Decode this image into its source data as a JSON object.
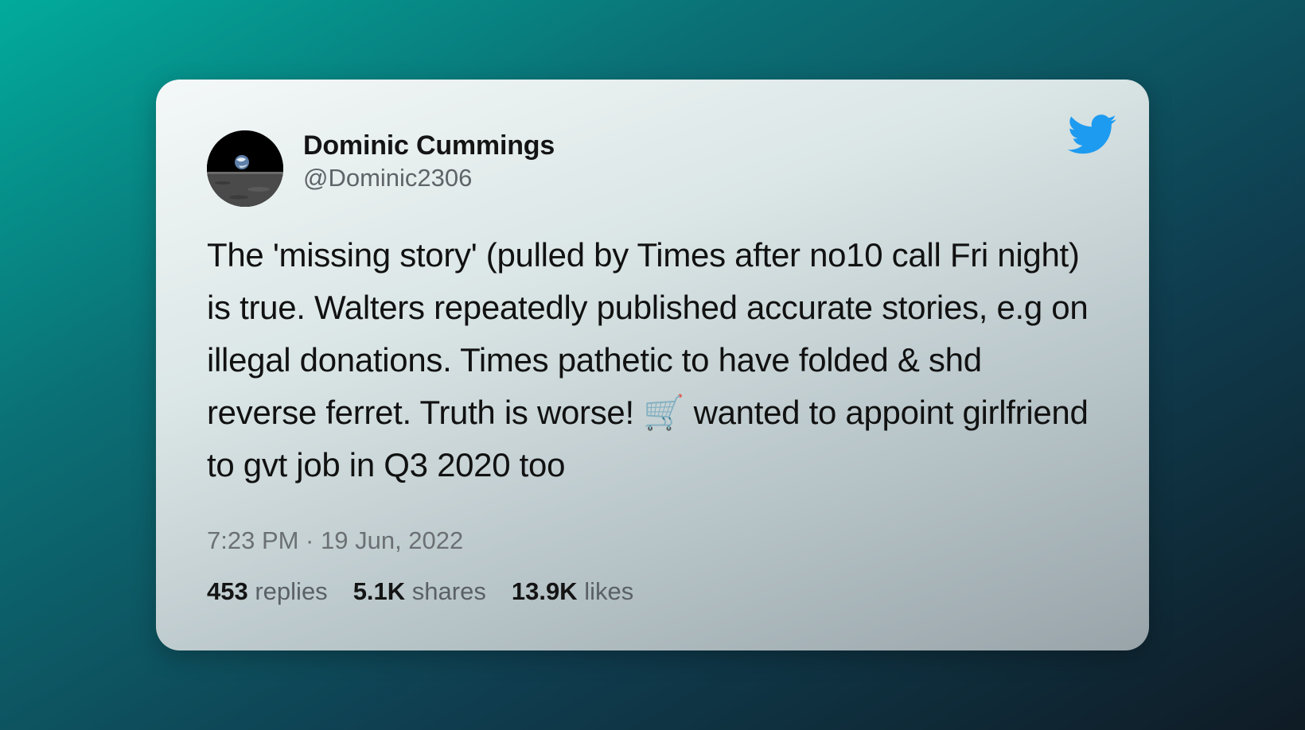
{
  "tweet": {
    "author_name": "Dominic Cummings",
    "author_handle": "@Dominic2306",
    "text": "The 'missing story' (pulled by Times after no10 call Fri night) is true. Walters repeatedly published accurate stories, e.g on illegal donations. Times pathetic to have folded & shd reverse ferret. Truth is worse! 🛒 wanted to appoint girlfriend to gvt job in Q3 2020 too",
    "timestamp": "7:23 PM · 19 Jun, 2022",
    "stats": {
      "replies_count": "453",
      "replies_label": "replies",
      "shares_count": "5.1K",
      "shares_label": "shares",
      "likes_count": "13.9K",
      "likes_label": "likes"
    }
  },
  "icons": {
    "brand": "twitter-bird-icon",
    "avatar": "earthrise-avatar"
  },
  "colors": {
    "twitter_blue": "#1d9bf0",
    "background_start": "#02ab9c",
    "background_end": "#0f1b25"
  }
}
